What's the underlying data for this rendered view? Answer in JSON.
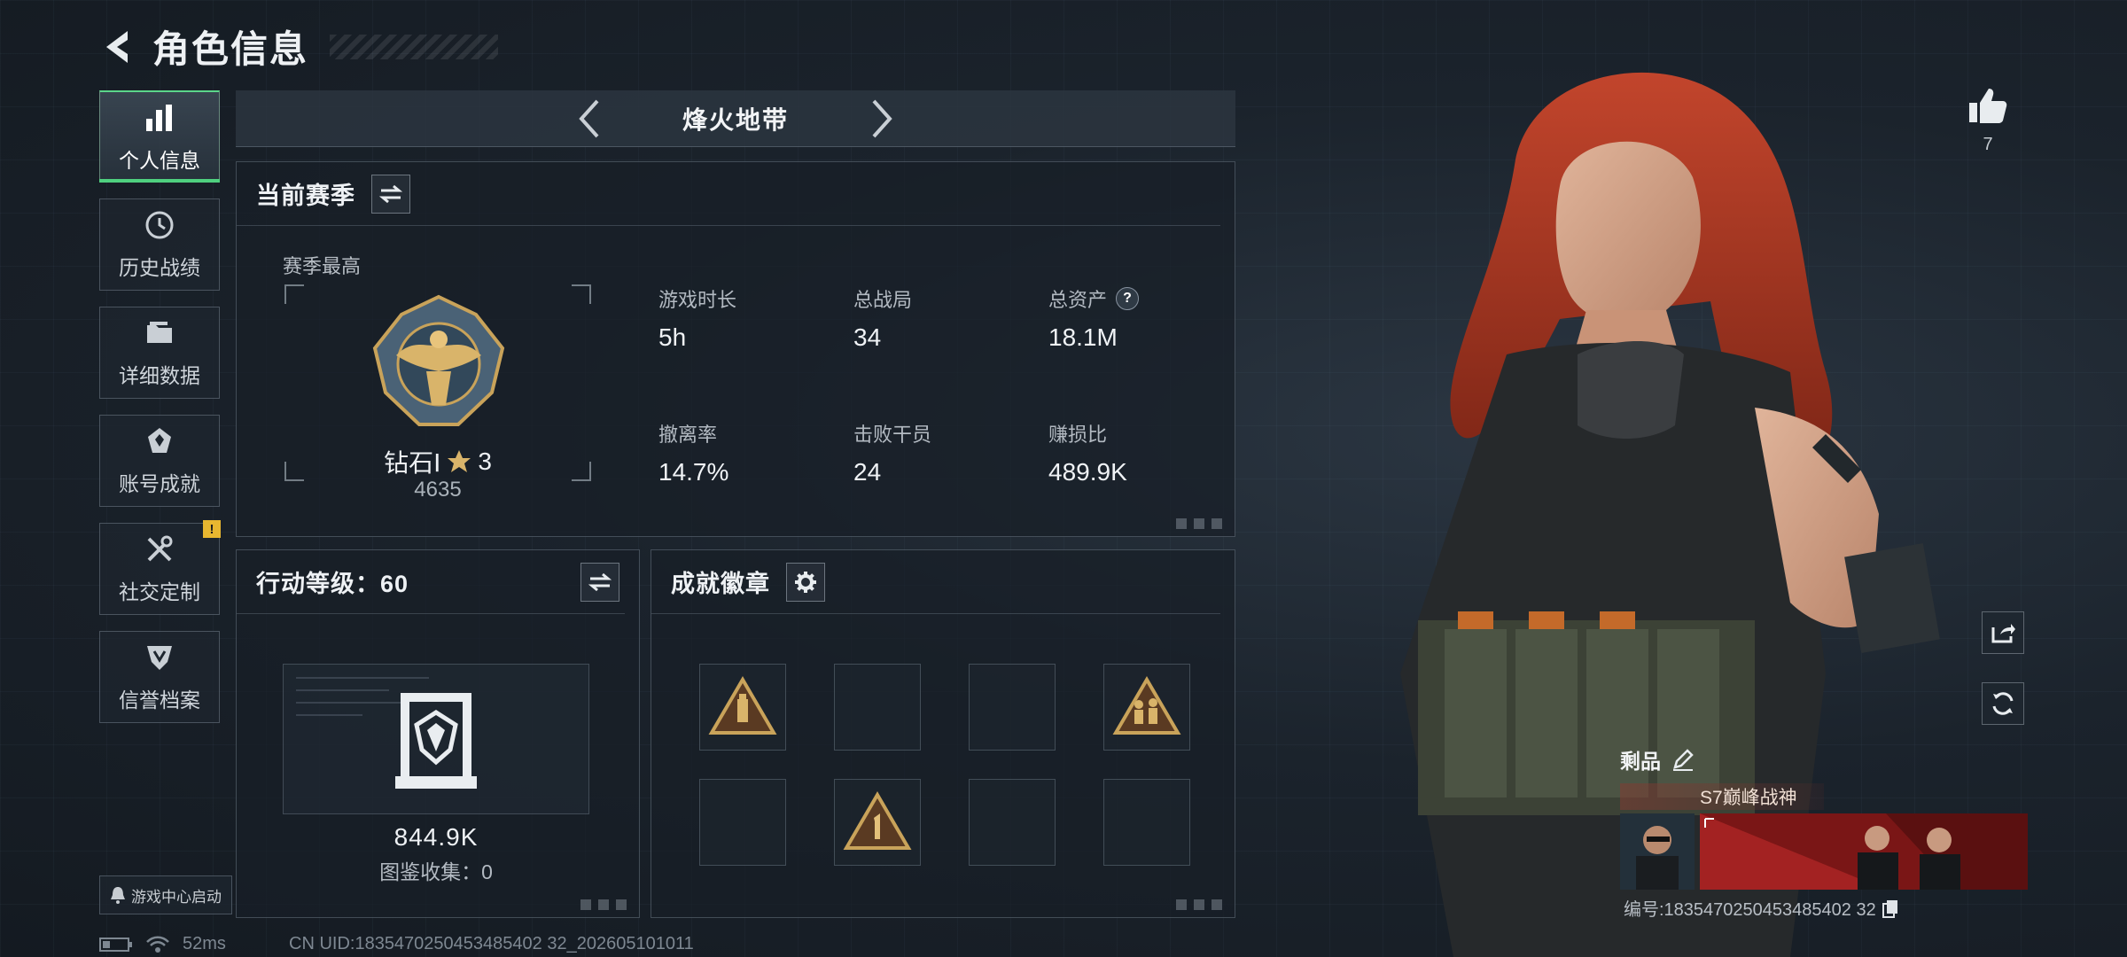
{
  "header": {
    "title": "角色信息"
  },
  "sidebar": {
    "items": [
      {
        "label": "个人信息",
        "icon": "bar-chart-icon",
        "active": true
      },
      {
        "label": "历史战绩",
        "icon": "history-icon"
      },
      {
        "label": "详细数据",
        "icon": "folder-icon"
      },
      {
        "label": "账号成就",
        "icon": "achievement-icon"
      },
      {
        "label": "社交定制",
        "icon": "tools-icon",
        "alert": "!"
      },
      {
        "label": "信誉档案",
        "icon": "shield-icon"
      }
    ],
    "launch_label": "游戏中心启动"
  },
  "mode": {
    "title": "烽火地带"
  },
  "season": {
    "title": "当前赛季",
    "peak_label": "赛季最高",
    "rank_name": "钻石Ⅰ",
    "rank_stars": "3",
    "rank_score": "4635",
    "stats": [
      {
        "label": "游戏时长",
        "value": "5h"
      },
      {
        "label": "总战局",
        "value": "34"
      },
      {
        "label": "总资产",
        "value": "18.1M",
        "help": "?"
      },
      {
        "label": "撤离率",
        "value": "14.7%"
      },
      {
        "label": "击败干员",
        "value": "24"
      },
      {
        "label": "赚损比",
        "value": "489.9K"
      }
    ]
  },
  "level": {
    "title": "行动等级：60",
    "value": "844.9K",
    "collection": "图鉴收集：0"
  },
  "badges": {
    "title": "成就徽章",
    "slots": [
      {
        "icon": "triangle-badge-bottle-icon",
        "filled": true
      },
      {
        "filled": false
      },
      {
        "filled": false
      },
      {
        "icon": "triangle-badge-soldiers-icon",
        "filled": true
      },
      {
        "filled": false
      },
      {
        "icon": "triangle-badge-number-one-icon",
        "filled": true
      },
      {
        "filled": false
      },
      {
        "filled": false
      }
    ]
  },
  "likes": {
    "count": "7"
  },
  "trophy": {
    "title": "剩品",
    "name": "S7巅峰战神",
    "id_text": "编号:1835470250453485402 32"
  },
  "status": {
    "ping": "52ms",
    "uid": "CN UID:1835470250453485402 32_202605101011"
  },
  "colors": {
    "accent_green": "#4fd07f",
    "alert_yellow": "#e8b730",
    "hair_red": "#b8402a"
  }
}
